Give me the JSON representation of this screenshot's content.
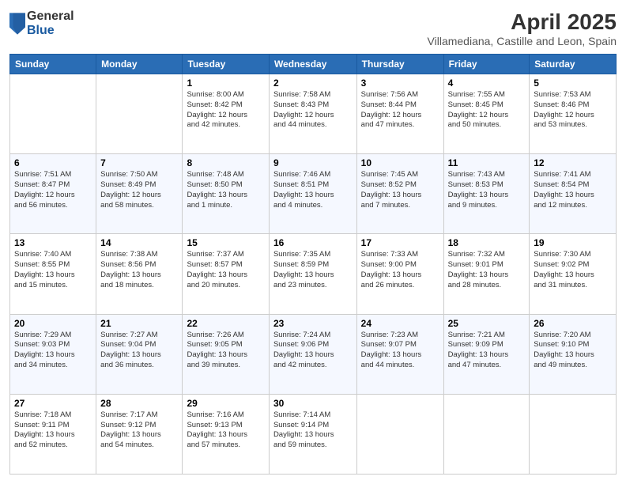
{
  "logo": {
    "general": "General",
    "blue": "Blue"
  },
  "title": "April 2025",
  "location": "Villamediana, Castille and Leon, Spain",
  "headers": [
    "Sunday",
    "Monday",
    "Tuesday",
    "Wednesday",
    "Thursday",
    "Friday",
    "Saturday"
  ],
  "weeks": [
    [
      {
        "day": "",
        "info": ""
      },
      {
        "day": "",
        "info": ""
      },
      {
        "day": "1",
        "info": "Sunrise: 8:00 AM\nSunset: 8:42 PM\nDaylight: 12 hours\nand 42 minutes."
      },
      {
        "day": "2",
        "info": "Sunrise: 7:58 AM\nSunset: 8:43 PM\nDaylight: 12 hours\nand 44 minutes."
      },
      {
        "day": "3",
        "info": "Sunrise: 7:56 AM\nSunset: 8:44 PM\nDaylight: 12 hours\nand 47 minutes."
      },
      {
        "day": "4",
        "info": "Sunrise: 7:55 AM\nSunset: 8:45 PM\nDaylight: 12 hours\nand 50 minutes."
      },
      {
        "day": "5",
        "info": "Sunrise: 7:53 AM\nSunset: 8:46 PM\nDaylight: 12 hours\nand 53 minutes."
      }
    ],
    [
      {
        "day": "6",
        "info": "Sunrise: 7:51 AM\nSunset: 8:47 PM\nDaylight: 12 hours\nand 56 minutes."
      },
      {
        "day": "7",
        "info": "Sunrise: 7:50 AM\nSunset: 8:49 PM\nDaylight: 12 hours\nand 58 minutes."
      },
      {
        "day": "8",
        "info": "Sunrise: 7:48 AM\nSunset: 8:50 PM\nDaylight: 13 hours\nand 1 minute."
      },
      {
        "day": "9",
        "info": "Sunrise: 7:46 AM\nSunset: 8:51 PM\nDaylight: 13 hours\nand 4 minutes."
      },
      {
        "day": "10",
        "info": "Sunrise: 7:45 AM\nSunset: 8:52 PM\nDaylight: 13 hours\nand 7 minutes."
      },
      {
        "day": "11",
        "info": "Sunrise: 7:43 AM\nSunset: 8:53 PM\nDaylight: 13 hours\nand 9 minutes."
      },
      {
        "day": "12",
        "info": "Sunrise: 7:41 AM\nSunset: 8:54 PM\nDaylight: 13 hours\nand 12 minutes."
      }
    ],
    [
      {
        "day": "13",
        "info": "Sunrise: 7:40 AM\nSunset: 8:55 PM\nDaylight: 13 hours\nand 15 minutes."
      },
      {
        "day": "14",
        "info": "Sunrise: 7:38 AM\nSunset: 8:56 PM\nDaylight: 13 hours\nand 18 minutes."
      },
      {
        "day": "15",
        "info": "Sunrise: 7:37 AM\nSunset: 8:57 PM\nDaylight: 13 hours\nand 20 minutes."
      },
      {
        "day": "16",
        "info": "Sunrise: 7:35 AM\nSunset: 8:59 PM\nDaylight: 13 hours\nand 23 minutes."
      },
      {
        "day": "17",
        "info": "Sunrise: 7:33 AM\nSunset: 9:00 PM\nDaylight: 13 hours\nand 26 minutes."
      },
      {
        "day": "18",
        "info": "Sunrise: 7:32 AM\nSunset: 9:01 PM\nDaylight: 13 hours\nand 28 minutes."
      },
      {
        "day": "19",
        "info": "Sunrise: 7:30 AM\nSunset: 9:02 PM\nDaylight: 13 hours\nand 31 minutes."
      }
    ],
    [
      {
        "day": "20",
        "info": "Sunrise: 7:29 AM\nSunset: 9:03 PM\nDaylight: 13 hours\nand 34 minutes."
      },
      {
        "day": "21",
        "info": "Sunrise: 7:27 AM\nSunset: 9:04 PM\nDaylight: 13 hours\nand 36 minutes."
      },
      {
        "day": "22",
        "info": "Sunrise: 7:26 AM\nSunset: 9:05 PM\nDaylight: 13 hours\nand 39 minutes."
      },
      {
        "day": "23",
        "info": "Sunrise: 7:24 AM\nSunset: 9:06 PM\nDaylight: 13 hours\nand 42 minutes."
      },
      {
        "day": "24",
        "info": "Sunrise: 7:23 AM\nSunset: 9:07 PM\nDaylight: 13 hours\nand 44 minutes."
      },
      {
        "day": "25",
        "info": "Sunrise: 7:21 AM\nSunset: 9:09 PM\nDaylight: 13 hours\nand 47 minutes."
      },
      {
        "day": "26",
        "info": "Sunrise: 7:20 AM\nSunset: 9:10 PM\nDaylight: 13 hours\nand 49 minutes."
      }
    ],
    [
      {
        "day": "27",
        "info": "Sunrise: 7:18 AM\nSunset: 9:11 PM\nDaylight: 13 hours\nand 52 minutes."
      },
      {
        "day": "28",
        "info": "Sunrise: 7:17 AM\nSunset: 9:12 PM\nDaylight: 13 hours\nand 54 minutes."
      },
      {
        "day": "29",
        "info": "Sunrise: 7:16 AM\nSunset: 9:13 PM\nDaylight: 13 hours\nand 57 minutes."
      },
      {
        "day": "30",
        "info": "Sunrise: 7:14 AM\nSunset: 9:14 PM\nDaylight: 13 hours\nand 59 minutes."
      },
      {
        "day": "",
        "info": ""
      },
      {
        "day": "",
        "info": ""
      },
      {
        "day": "",
        "info": ""
      }
    ]
  ]
}
